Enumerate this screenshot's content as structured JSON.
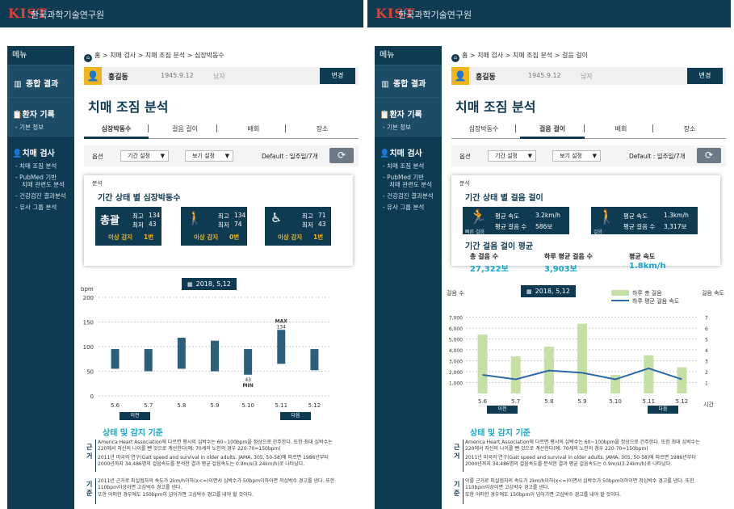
{
  "panel_a": {
    "brand": {
      "logo": "KIST",
      "name": "한국과학기술연구원"
    },
    "menu_label": "메뉴",
    "nav": {
      "summary": "종합 결과",
      "patient_record": "환자 기록",
      "basic_info": "- 기본 정보",
      "dementia_test": "치매 검사",
      "subs": [
        "- 치매 조짐 분석",
        "- PubMed 기반",
        "치매 관련도 분석",
        "- 건강검진 결과분석",
        "- 유사 그룹 분석"
      ]
    },
    "breadcrumb": "홈  >  치매 검사  >  치매 조짐 분석  >  심장박동수",
    "patient": {
      "name": "홍길동",
      "dob": "1945.9.12",
      "sex": "남자"
    },
    "change_button": "변경",
    "page_title": "치매 조짐 분석",
    "tabs": [
      "심장박동수",
      "걸음 걸이",
      "배회",
      "장소"
    ],
    "active_tab": "심장박동수",
    "options": {
      "label": "옵션",
      "period": "기간 설정",
      "view": "보기 설정",
      "default": "Default : 일주일/7개"
    },
    "card": {
      "label": "분석",
      "title": "기간 상태 별 심장박동수",
      "boxes": [
        {
          "name": "총괄",
          "max_label": "최고",
          "max": "134",
          "min_label": "최저",
          "min": "43",
          "warn_label": "이상 감지",
          "warn": "1번"
        },
        {
          "max_label": "최고",
          "max": "134",
          "min_label": "최저",
          "min": "74",
          "warn_label": "이상 감지",
          "warn": "0번"
        },
        {
          "max_label": "최고",
          "max": "71",
          "min_label": "최저",
          "min": "43",
          "warn_label": "이상 감지",
          "warn": "1번"
        }
      ]
    },
    "date": "2018, 5,12",
    "prev": "이전",
    "next": "다음",
    "chart_data": {
      "type": "bar",
      "ylabel": "bpm",
      "categories": [
        "5.6",
        "5.7",
        "5.8",
        "5.9",
        "5.10",
        "5.11",
        "5.12"
      ],
      "series": [
        {
          "low": [
            55,
            50,
            55,
            50,
            43,
            65,
            52
          ],
          "high": [
            95,
            95,
            118,
            112,
            95,
            134,
            95
          ]
        }
      ],
      "ylim": [
        0,
        200
      ],
      "yticks": [
        0,
        50,
        100,
        150,
        200
      ],
      "annotations": [
        {
          "text": "MAX",
          "value": "134"
        },
        {
          "text": "43",
          "sub": "MIN"
        }
      ]
    },
    "criteria_title": "상태 및 감지 기준",
    "criteria": {
      "k1": "근거",
      "t1": "America Heart Association에 다르면 평시의 심박수는 60~100bpm을 정상으로 간주한다. 또한 최대 심박수는 220에서 자신의 나이를 뺀 것으로 계산한다(예: 70세의 노인의 경우 220-70=150bpm)",
      "t2": "2011년 미국의 연구(Gait speed and survival in older adults. JAMA, 305, 50-58)에 따르면 1986년부터 2000년까지 34,486명의 걸음속도를 분석한 결과 평균 걸음속도는 0.9m/s(3.24km/h)로 나타났다.",
      "k2": "기준",
      "t3": "2011년 근거로 피실험자의 속도가 2km/h이하(x<=)이면서 심박수가 50bpm이하이면 저심박수 경고를 낸다. 또한 110bpm이상이면 고심박수 경고를 낸다.",
      "t4": "또한 어떠한 경우에도 150bpm이 넘어가면 고심박수 경고를 내야 할 것이다."
    }
  },
  "panel_b": {
    "brand": {
      "logo": "KIST",
      "name": "한국과학기술연구원"
    },
    "menu_label": "메뉴",
    "nav": {
      "summary": "종합 결과",
      "patient_record": "환자 기록",
      "basic_info": "- 기본 정보",
      "dementia_test": "치매 검사",
      "subs": [
        "- 치매 조짐 분석",
        "- PubMed 기반",
        "치매 관련도 분석",
        "- 건강검진 결과분석",
        "- 유사 그룹 분석"
      ]
    },
    "breadcrumb": "홈  >  치매 검사  >  치매 조짐 분석  >  걸음 걸이",
    "patient": {
      "name": "홍길동",
      "dob": "1945.9.12",
      "sex": "남자"
    },
    "change_button": "변경",
    "page_title": "치매 조짐 분석",
    "tabs": [
      "심장박동수",
      "걸음 걸이",
      "배회",
      "장소"
    ],
    "active_tab": "걸음 걸이",
    "options": {
      "label": "옵션",
      "period": "기간 설정",
      "view": "보기 설정",
      "default": "Default : 일주일/7개"
    },
    "card": {
      "label": "분석",
      "title": "기간 상태 별 걸음 걸이",
      "boxes": [
        {
          "icon_label": "빠른 걸음",
          "r1_label": "평균 속도",
          "r1": "3.2km/h",
          "r2_label": "평균 걸음 수",
          "r2": "586보"
        },
        {
          "icon_label": "걸음",
          "r1_label": "평균 속도",
          "r1": "1.3km/h",
          "r2_label": "평균 걸음 수",
          "r2": "3,317보"
        }
      ],
      "avg_title": "기간 걸음 걸이 평균",
      "avgs": [
        {
          "label": "총 걸음 수",
          "value": "27,322보"
        },
        {
          "label": "하루 평균 걸음 수",
          "value": "3,903보"
        },
        {
          "label": "평균 속도",
          "value": "1.8km/h"
        }
      ]
    },
    "date": "2018, 5,12",
    "prev": "이전",
    "next": "다음",
    "chart_data": {
      "type": "bar",
      "ylabel_left": "걸음 수",
      "ylabel_right": "걸음 속도",
      "xlabel": "시간",
      "categories": [
        "5.6",
        "5.7",
        "5.8",
        "5.9",
        "5.10",
        "5.11",
        "5.12"
      ],
      "series": [
        {
          "name": "하루 총 걸음",
          "type": "bar",
          "axis": "left",
          "values": [
            5400,
            3400,
            4300,
            6400,
            1700,
            3500,
            2400
          ]
        },
        {
          "name": "하루 평균 걸음 속도",
          "type": "line",
          "axis": "right",
          "values": [
            1.7,
            1.3,
            2.1,
            1.9,
            1.3,
            2.3,
            1.3
          ]
        }
      ],
      "ylim_left": [
        0,
        8000
      ],
      "yticks_left": [
        "1,000",
        "2,000",
        "3,000",
        "4,000",
        "5,000",
        "6,000",
        "7,000"
      ],
      "ylim_right": [
        0,
        8
      ],
      "yticks_right": [
        "1",
        "2",
        "3",
        "4",
        "5",
        "6",
        "7"
      ],
      "colors": {
        "bars": "#c5e0a5",
        "line": "#2b6aa6"
      }
    },
    "criteria_title": "상태 및 감지 기준",
    "criteria": {
      "k1": "근거",
      "t1": "America Heart Association에 다르면 평시의 심박수는 60~100bpm을 정상으로 간주한다. 또한 최대 심박수는 220에서 자신의 나이를 뺀 것으로 계산한다(예: 70세의 노인의 경우 220-70=150bpm)",
      "t2": "2011년 미국의 연구(Gait speed and survival in older adults. JAMA, 305, 50-58)에 따르면 1986년부터 2000년까지 34,486명의 걸음속도를 분석한 결과 평균 걸음속도는 0.9m/s(3.24km/h)로 나타났다.",
      "k2": "기준",
      "t3": "이를 근거로 피실험자의 속도가 2km/h이하(x<=)이면서 심박수가 50bpm이하이면 저심박수 경고를 낸다. 또한 110bpm이상이면 고심박수 경고를 낸다.",
      "t4": "또한 어떠한 경우에도 150bpm이 넘어가면 고심박수 경고를 내야 할 것이다."
    }
  }
}
